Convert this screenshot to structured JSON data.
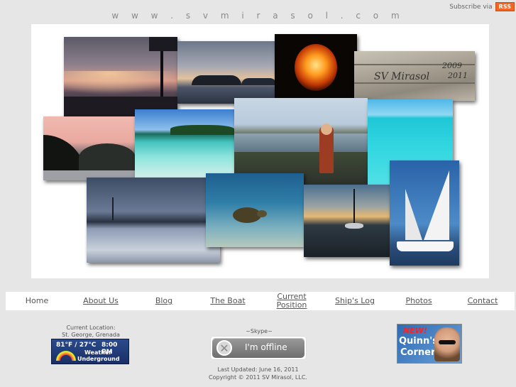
{
  "header": {
    "site_url": "w w w . s v m i r a s o l . c o m",
    "subscribe_text": "Subscribe via",
    "rss_badge": "RSS"
  },
  "collage": {
    "photos": [
      {
        "name": "sunset-harbor-photo"
      },
      {
        "name": "sunset-islands-photo"
      },
      {
        "name": "fire-lantern-photo"
      },
      {
        "name": "mirasol-sign-photo",
        "carving": "SV Mirasol",
        "years": [
          "2009",
          "2011"
        ]
      },
      {
        "name": "pink-dusk-hills-photo"
      },
      {
        "name": "palm-island-beach-photo"
      },
      {
        "name": "child-overlook-photo"
      },
      {
        "name": "turquoise-water-photo"
      },
      {
        "name": "calm-shore-photo"
      },
      {
        "name": "sea-turtle-photo"
      },
      {
        "name": "anchorage-sunset-photo"
      },
      {
        "name": "catamaran-sailing-photo"
      }
    ]
  },
  "nav": {
    "items": [
      {
        "label": "Home",
        "link": false
      },
      {
        "label": "About Us",
        "link": true
      },
      {
        "label": "Blog",
        "link": true
      },
      {
        "label": "The Boat",
        "link": true
      },
      {
        "label": "Current Position",
        "link": true
      },
      {
        "label": "Ship's Log",
        "link": true
      },
      {
        "label": "Photos",
        "link": true
      },
      {
        "label": "Contact",
        "link": true
      }
    ]
  },
  "location": {
    "title": "Current Location:",
    "name": "St. George, Grenada"
  },
  "weather": {
    "temperature": "81°F / 27°C",
    "time": "8:00 PM",
    "brand_line1": "Weather",
    "brand_line2": "Underground"
  },
  "skype": {
    "title": "~Skype~",
    "status": "I'm offline"
  },
  "footer": {
    "last_updated": "Last Updated: June 16, 2011",
    "copyright": "Copyright © 2011 SV Mirasol, LLC."
  },
  "quinn": {
    "badge": "NEW!",
    "line1": "Quinn's",
    "line2": "Corner"
  },
  "colors": {
    "page_background": "#e6e6e6",
    "rss_orange": "#f26522",
    "nav_text": "#555555"
  }
}
